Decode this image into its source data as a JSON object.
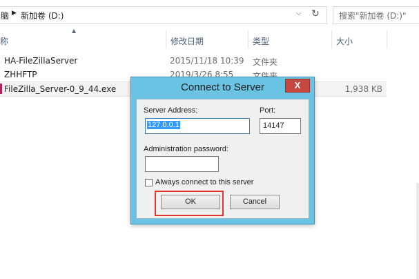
{
  "address_bar": {
    "first_crumb": "脑",
    "drive": "新加卷 (D:)",
    "search_placeholder": "搜索\"新加卷 (D:)\""
  },
  "columns": {
    "name": "称",
    "modified": "修改日期",
    "type": "类型",
    "size": "大小"
  },
  "files": [
    {
      "name": "HA-FileZillaServer",
      "modified": "2015/11/18 10:39",
      "type": "文件夹",
      "size": ""
    },
    {
      "name": "ZHHFTP",
      "modified": "2019/3/26 8:55",
      "type": "文件夹",
      "size": ""
    },
    {
      "name": "FileZilla_Server-0_9_44.exe",
      "modified": "",
      "type": "",
      "size": "1,938 KB"
    }
  ],
  "dialog": {
    "title": "Connect to Server",
    "close_glyph": "X",
    "server_address_label": "Server Address:",
    "server_address_value": "127.0.0.1",
    "port_label": "Port:",
    "port_value": "14147",
    "password_label": "Administration password:",
    "password_value": "",
    "always_connect_label": "Always connect to this server",
    "always_connect_checked": false,
    "ok_label": "OK",
    "cancel_label": "Cancel",
    "highlight_color": "#e0342e"
  },
  "icons": {
    "crumb_separator": "▶",
    "dropdown": "⌵",
    "refresh": "↻",
    "sort": "▲"
  }
}
